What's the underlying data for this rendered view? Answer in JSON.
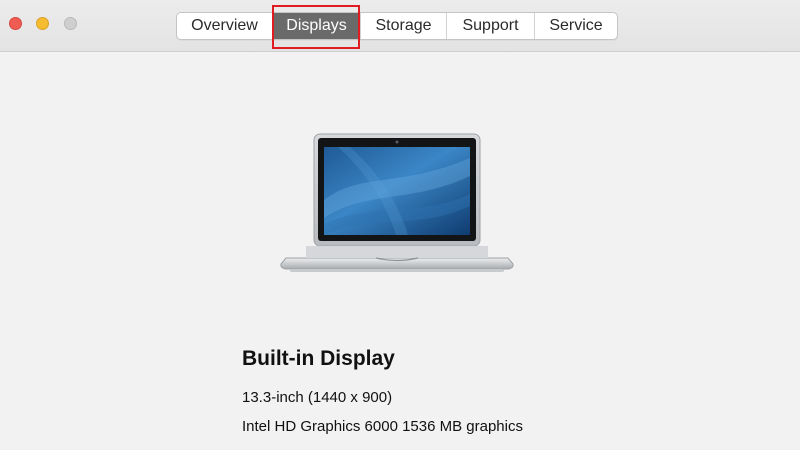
{
  "window": {
    "traffic_lights": {
      "close_color": "#ee5c54",
      "minimize_color": "#f5bc2f",
      "zoom_color": "#cfcfcf"
    }
  },
  "tabs": [
    {
      "label": "Overview",
      "selected": false
    },
    {
      "label": "Displays",
      "selected": true
    },
    {
      "label": "Storage",
      "selected": false
    },
    {
      "label": "Support",
      "selected": false
    },
    {
      "label": "Service",
      "selected": false
    }
  ],
  "highlight": {
    "color": "#e11b22",
    "target": "tab-displays"
  },
  "display": {
    "image": "laptop-icon",
    "name": "Built-in Display",
    "size_resolution": "13.3-inch (1440 x 900)",
    "graphics": "Intel HD Graphics 6000 1536 MB graphics"
  }
}
